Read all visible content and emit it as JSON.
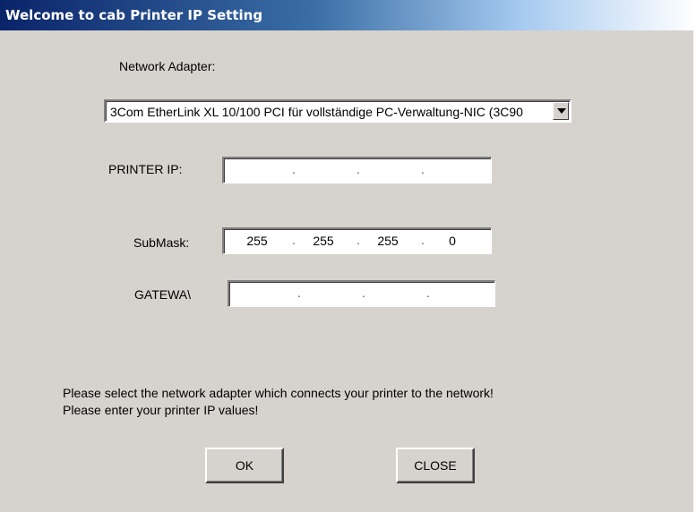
{
  "window": {
    "title": "Welcome to cab Printer IP Setting"
  },
  "adapter": {
    "label": "Network Adapter:",
    "selected": "3Com EtherLink XL 10/100 PCI für vollständige PC-Verwaltung-NIC (3C90"
  },
  "printer_ip": {
    "label": "PRINTER IP:",
    "octets": [
      "",
      "",
      "",
      ""
    ]
  },
  "submask": {
    "label": "SubMask:",
    "octets": [
      "255",
      "255",
      "255",
      "0"
    ]
  },
  "gateway": {
    "label": "GATEWA\\",
    "octets": [
      "",
      "",
      "",
      ""
    ]
  },
  "messages": {
    "line1": "Please select the network adapter which connects your printer to the network!",
    "line2": "Please enter your printer IP values!"
  },
  "buttons": {
    "ok": "OK",
    "close": "CLOSE"
  }
}
